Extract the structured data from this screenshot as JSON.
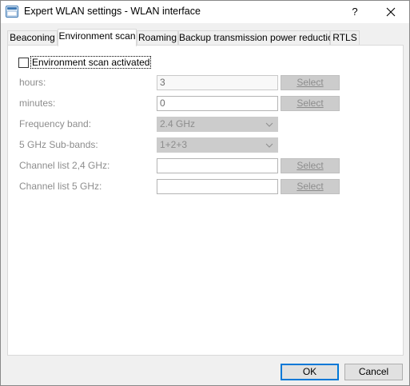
{
  "window": {
    "title": "Expert WLAN settings - WLAN interface",
    "help_label": "?",
    "close_icon": "close-icon"
  },
  "tabs": [
    {
      "label": "Beaconing",
      "active": false
    },
    {
      "label": "Environment scan",
      "active": true
    },
    {
      "label": "Roaming",
      "active": false
    },
    {
      "label": "Backup transmission power reduction",
      "active": false
    },
    {
      "label": "RTLS",
      "active": false
    }
  ],
  "environment_scan": {
    "activated_label": "Environment scan activated",
    "activated_checked": false,
    "hours": {
      "label": "hours:",
      "value": "3",
      "button": "Select"
    },
    "minutes": {
      "label": "minutes:",
      "value": "0",
      "button": "Select"
    },
    "frequency_band": {
      "label": "Frequency band:",
      "value": "2.4 GHz"
    },
    "sub_bands": {
      "label": "5 GHz Sub-bands:",
      "value": "1+2+3"
    },
    "channel_list_24": {
      "label": "Channel list 2,4 GHz:",
      "value": "",
      "button": "Select"
    },
    "channel_list_5": {
      "label": "Channel list 5 GHz:",
      "value": "",
      "button": "Select"
    }
  },
  "footer": {
    "ok_label": "OK",
    "cancel_label": "Cancel"
  },
  "colors": {
    "accent": "#0078d7",
    "disabled_text": "#8d8d8d"
  }
}
